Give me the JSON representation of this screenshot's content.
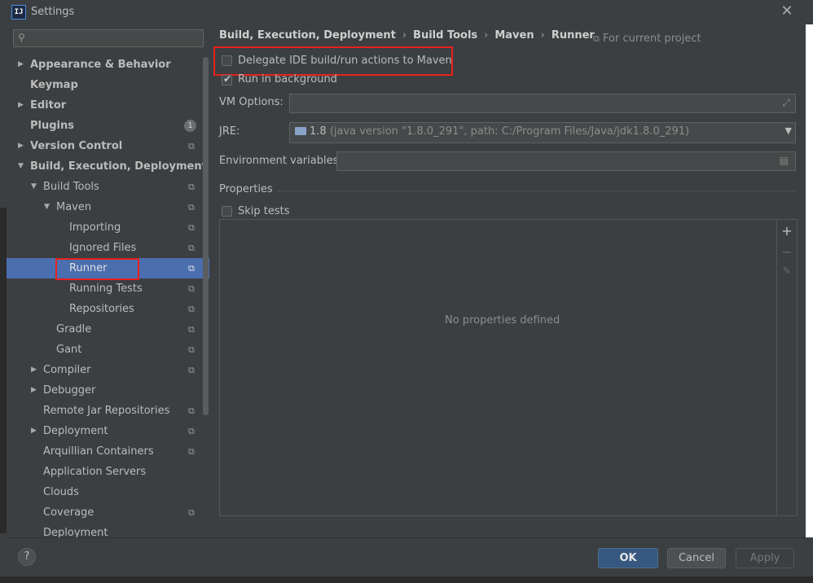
{
  "window": {
    "title": "Settings",
    "app_icon_text": "IJ",
    "close_glyph": "✕"
  },
  "sidebar": {
    "search_placeholder": "",
    "items": [
      {
        "label": "Appearance & Behavior",
        "bold": true,
        "arrow": "▶",
        "project": false
      },
      {
        "label": "Keymap",
        "bold": true,
        "arrow": "",
        "project": false
      },
      {
        "label": "Editor",
        "bold": true,
        "arrow": "▶",
        "project": false
      },
      {
        "label": "Plugins",
        "bold": true,
        "arrow": "",
        "badge": "1"
      },
      {
        "label": "Version Control",
        "bold": true,
        "arrow": "▶",
        "project": true
      },
      {
        "label": "Build, Execution, Deployment",
        "bold": true,
        "arrow": "▼",
        "project": false
      },
      {
        "label": "Build Tools",
        "arrow": "▼",
        "project": true
      },
      {
        "label": "Maven",
        "arrow": "▼",
        "project": true
      },
      {
        "label": "Importing",
        "project": true
      },
      {
        "label": "Ignored Files",
        "project": true
      },
      {
        "label": "Runner",
        "project": true,
        "selected": true
      },
      {
        "label": "Running Tests",
        "project": true
      },
      {
        "label": "Repositories",
        "project": true
      },
      {
        "label": "Gradle",
        "project": true
      },
      {
        "label": "Gant",
        "project": true
      },
      {
        "label": "Compiler",
        "arrow": "▶",
        "project": true
      },
      {
        "label": "Debugger",
        "arrow": "▶",
        "project": false
      },
      {
        "label": "Remote Jar Repositories",
        "project": true
      },
      {
        "label": "Deployment",
        "arrow": "▶",
        "project": true
      },
      {
        "label": "Arquillian Containers",
        "project": true
      },
      {
        "label": "Application Servers",
        "project": false
      },
      {
        "label": "Clouds",
        "project": false
      },
      {
        "label": "Coverage",
        "project": true
      },
      {
        "label": "Deployment",
        "project": false
      }
    ]
  },
  "breadcrumb": {
    "parts": [
      "Build, Execution, Deployment",
      "Build Tools",
      "Maven",
      "Runner"
    ],
    "separator": "›",
    "scope": "For current project"
  },
  "runner": {
    "delegate_label": "Delegate IDE build/run actions to Maven",
    "delegate_checked": false,
    "background_label": "Run in background",
    "background_checked": true,
    "vm_options_label": "VM Options:",
    "vm_options_value": "",
    "jre_label": "JRE:",
    "jre_version": "1.8",
    "jre_detail": "(java version \"1.8.0_291\", path: C:/Program Files/Java/jdk1.8.0_291)",
    "env_label": "Environment variables:",
    "env_value": "",
    "properties_title": "Properties",
    "skip_tests_label": "Skip tests",
    "skip_tests_checked": false,
    "empty_properties": "No properties defined"
  },
  "footer": {
    "help": "?",
    "ok": "OK",
    "cancel": "Cancel",
    "apply": "Apply"
  },
  "colors": {
    "selection": "#4b6eaf",
    "highlight_box": "#e8201c",
    "ok_button": "#365880"
  }
}
